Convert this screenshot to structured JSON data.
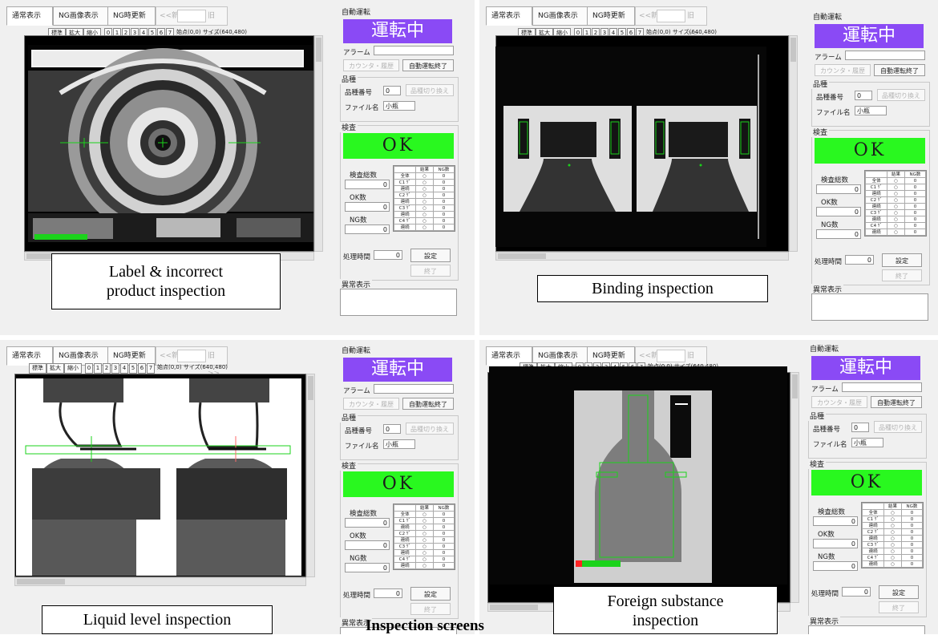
{
  "ui": {
    "tab_normal": "通常表示",
    "tab_ng_image": "NG画像表示",
    "tab_ng_update": "NG時更新",
    "nav_prev": "<<新",
    "nav_next": "旧>>",
    "tb_standard": "標準",
    "tb_zoom_in": "拡大",
    "tb_zoom_out": "縮小",
    "tb_numbers": [
      "0",
      "1",
      "2",
      "3",
      "4",
      "5",
      "6",
      "7"
    ],
    "tb_info": "始点(0,0) サイズ(640,480)",
    "auto_run_group": "自動運転",
    "running": "運転中",
    "alarm_label": "アラーム",
    "counter_history_button": "カウンタ・履歴",
    "auto_run_end_button": "自動運転終了",
    "product_group": "品種",
    "product_number_label": "品種番号",
    "product_number_value": "0",
    "product_switch_button": "品種切り換え",
    "file_name_label": "ファイル名",
    "file_name_value": "小瓶",
    "inspection_group": "検査",
    "result_ok": "OK",
    "total_count_label": "検査総数",
    "ok_count_label": "OK数",
    "ng_count_label": "NG数",
    "count_value": "0",
    "result_header": "結果",
    "ng_count_header": "NG数",
    "table_rows": [
      "全体",
      "C1 ｹﾞ",
      "連続",
      "C2 ｹﾞ",
      "連続",
      "C3 ｹﾞ",
      "連続",
      "C4 ｹﾞ",
      "連続"
    ],
    "result_symbol": "○",
    "processing_time_label": "処理時間",
    "processing_time_value": "0",
    "settings_button": "設定",
    "end_button": "終了",
    "abnormal_group": "異常表示"
  },
  "captions": {
    "label_inspection": [
      "Label & incorrect",
      "product inspection"
    ],
    "binding_inspection": "Binding inspection",
    "liquid_level_inspection": "Liquid level inspection",
    "foreign_substance_inspection": [
      "Foreign substance",
      "inspection"
    ],
    "overall": "Inspection screens"
  },
  "colors": {
    "running_bg": "#8a4af5",
    "ok_bg": "#29f81f",
    "overlay_green": "#1bd31b"
  }
}
